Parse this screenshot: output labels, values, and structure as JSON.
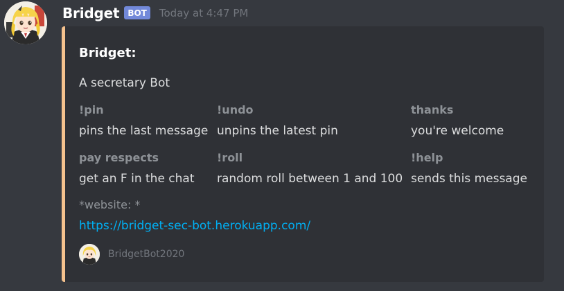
{
  "message": {
    "username": "Bridget",
    "bot_tag": "BOT",
    "timestamp": "Today at 4:47 PM"
  },
  "embed": {
    "accent_color": "#f5c28e",
    "title": "Bridget:",
    "description": "A secretary Bot",
    "fields": [
      {
        "name": "!pin",
        "value": "pins the last message"
      },
      {
        "name": "!undo",
        "value": "unpins the latest pin"
      },
      {
        "name": "thanks",
        "value": "you're welcome"
      },
      {
        "name": "pay respects",
        "value": "get an F in the chat"
      },
      {
        "name": "!roll",
        "value": "random roll between 1 and 100"
      },
      {
        "name": "!help",
        "value": "sends this message"
      }
    ],
    "website_label": "*website: *",
    "website_url": "https://bridget-sec-bot.herokuapp.com/",
    "footer": {
      "text": "BridgetBot2020"
    }
  },
  "colors": {
    "background": "#36393f",
    "embed_background": "#2f3136",
    "bot_tag": "#7289da",
    "link": "#00b0f4"
  },
  "icons": {
    "avatar": "anime-girl-avatar",
    "footer_icon": "anime-girl-avatar"
  }
}
